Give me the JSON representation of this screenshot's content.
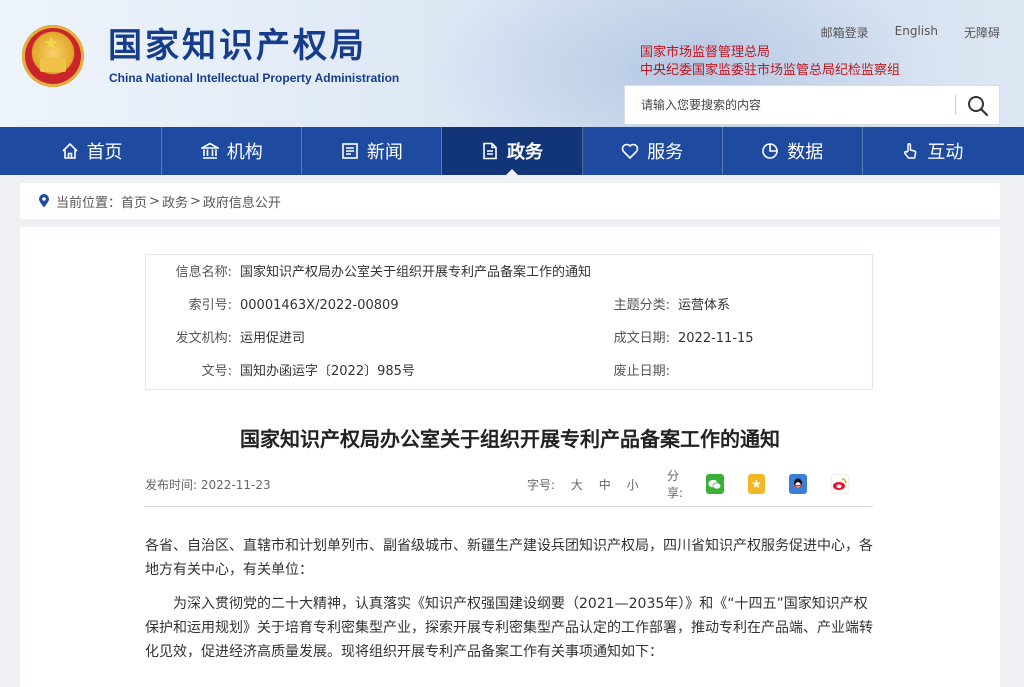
{
  "header": {
    "logo_cn": "国家知识产权局",
    "logo_en": "China National Intellectual Property Administration",
    "top_links": [
      "邮箱登录",
      "English",
      "无障碍"
    ],
    "affiliations": [
      "国家市场监督管理总局",
      "中央纪委国家监委驻市场监管总局纪检监察组"
    ],
    "search_placeholder": "请输入您要搜索的内容"
  },
  "nav": {
    "items": [
      {
        "label": "首页",
        "icon": "home-icon"
      },
      {
        "label": "机构",
        "icon": "institution-icon"
      },
      {
        "label": "新闻",
        "icon": "news-icon"
      },
      {
        "label": "政务",
        "icon": "document-icon",
        "active": true
      },
      {
        "label": "服务",
        "icon": "service-icon"
      },
      {
        "label": "数据",
        "icon": "pie-chart-icon"
      },
      {
        "label": "互动",
        "icon": "hand-pointer-icon"
      }
    ]
  },
  "breadcrumb": {
    "prefix": "当前位置：",
    "items": [
      "首页",
      "政务",
      "政府信息公开"
    ],
    "separator": ">"
  },
  "meta": {
    "info_name_label": "信息名称:",
    "info_name_value": "国家知识产权局办公室关于组织开展专利产品备案工作的通知",
    "index_label": "索引号:",
    "index_value": "00001463X/2022-00809",
    "topic_label": "主题分类:",
    "topic_value": "运营体系",
    "issuer_label": "发文机构:",
    "issuer_value": "运用促进司",
    "date_label": "成文日期:",
    "date_value": "2022-11-15",
    "docno_label": "文号:",
    "docno_value": "国知办函运字〔2022〕985号",
    "abolish_label": "废止日期:",
    "abolish_value": ""
  },
  "article": {
    "title": "国家知识产权局办公室关于组织开展专利产品备案工作的通知",
    "publish_label": "发布时间:",
    "publish_date": "2022-11-23",
    "font_size_label": "字号:",
    "font_sizes": [
      "大",
      "中",
      "小"
    ],
    "share_label": "分享:",
    "paragraphs": [
      "各省、自治区、直辖市和计划单列市、副省级城市、新疆生产建设兵团知识产权局，四川省知识产权服务促进中心，各地方有关中心，有关单位：",
      "为深入贯彻党的二十大精神，认真落实《知识产权强国建设纲要（2021—2035年）》和《“十四五”国家知识产权保护和运用规划》关于培育专利密集型产业，探索开展专利密集型产品认定的工作部署，推动专利在产品端、产业端转化见效，促进经济高质量发展。现将组织开展专利产品备案工作有关事项通知如下："
    ]
  },
  "colors": {
    "nav_bg": "#1e4ba0",
    "nav_active": "#12357a",
    "logo_blue": "#163d8c",
    "affil_red": "#c0161f"
  }
}
